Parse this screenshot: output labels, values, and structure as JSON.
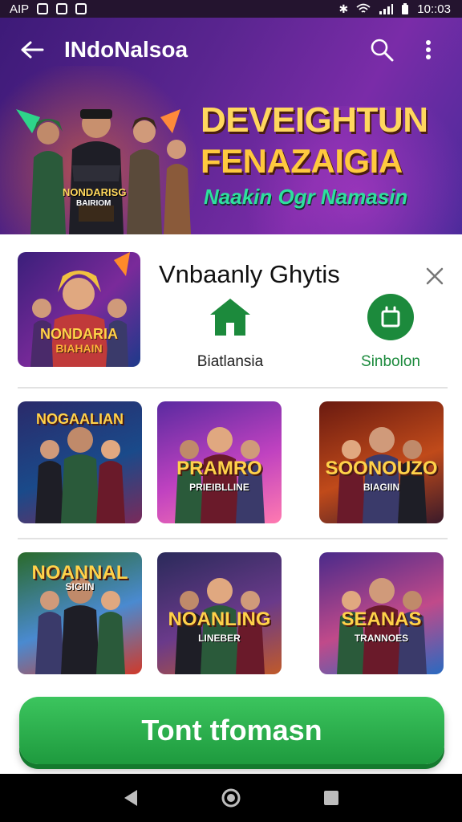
{
  "status_bar": {
    "carrier": "AIP",
    "time": "10::03"
  },
  "app_bar": {
    "title": "INdoNalsoa"
  },
  "hero": {
    "title_line1": "DEVEIGHTUN",
    "title_line2": "FENAZAIGIA",
    "subtitle": "Naakin Ogr Namasin",
    "badge_line1": "NONDARISG",
    "badge_line2": "BAIRIOM"
  },
  "feature": {
    "name": "Vnbaanly Ghytis",
    "thumb_caption_1": "NONDARIA",
    "thumb_caption_2": "BIAHAIN",
    "actions": [
      {
        "label": "Biatlansia",
        "icon": "home-icon"
      },
      {
        "label": "Sinbolon",
        "icon": "share-icon"
      }
    ]
  },
  "games": [
    {
      "caption": "NOGAALIAN",
      "sub": "",
      "colors": [
        "#2a2a6a",
        "#1a4a8a",
        "#7a2a5a"
      ]
    },
    {
      "caption": "PRAMRO",
      "sub": "PRIEIBLLINE",
      "colors": [
        "#5a2aa0",
        "#c042c0",
        "#ff7ab0"
      ]
    },
    {
      "caption": "SOONOUZO",
      "sub": "BIAGIIN",
      "colors": [
        "#6a1a10",
        "#c04a1a",
        "#3a1a2a"
      ]
    },
    {
      "caption": "NOANNAL",
      "sub": "SIGIIN",
      "colors": [
        "#2a6a2a",
        "#4a8ad0",
        "#d03a2a"
      ]
    },
    {
      "caption": "NOANLING",
      "sub": "LINEBER",
      "colors": [
        "#2a2a5a",
        "#6a3a8a",
        "#c05a2a"
      ]
    },
    {
      "caption": "SEANAS",
      "sub": "TRANNOES",
      "colors": [
        "#4a2a8a",
        "#c04a8a",
        "#2a6ac0"
      ]
    }
  ],
  "cta": {
    "label": "Tont tfomasn"
  },
  "colors": {
    "accent_green": "#1e9a3e",
    "hero_purple": "#5a2590"
  }
}
